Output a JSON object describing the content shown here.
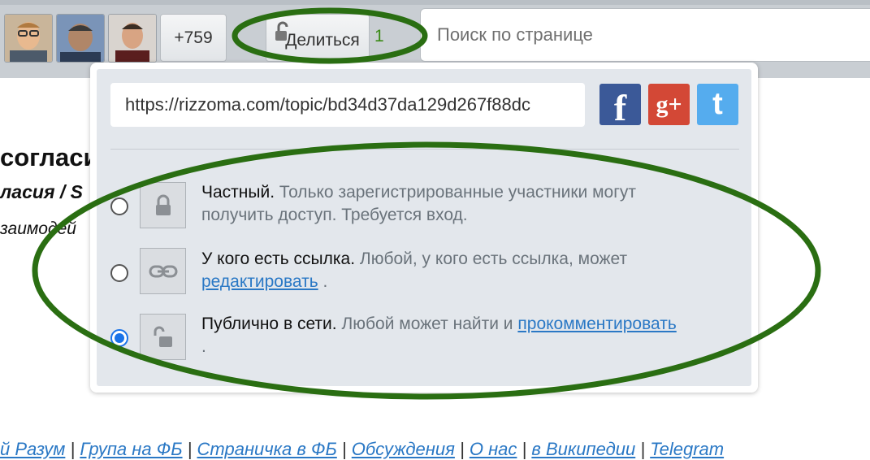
{
  "topbar": {
    "avatars": [
      "avatar-1",
      "avatar-2",
      "avatar-3"
    ],
    "more_count": "+759",
    "share_button": "Делиться",
    "share_count": "1",
    "search_placeholder": "Поиск по странице"
  },
  "background": {
    "title_fragment": "согласи",
    "subtitle_fragment": "ласия / S",
    "text_fragment": "заимодей"
  },
  "share_popup": {
    "url": "https://rizzoma.com/topic/bd34d37da129d267f88dc",
    "social": [
      {
        "name": "facebook",
        "glyph": "f",
        "color": "#3b5998"
      },
      {
        "name": "google-plus",
        "glyph": "g+",
        "color": "#d34836"
      },
      {
        "name": "twitter",
        "glyph": "t",
        "color": "#55acee"
      }
    ],
    "options": [
      {
        "title": "Частный.",
        "desc": "Только зарегистрированные участники могут получить доступ. Требуется вход.",
        "checked": false
      },
      {
        "title": "У кого есть ссылка.",
        "desc": "Любой, у кого есть ссылка, может",
        "link": "редактировать",
        "tail": ".",
        "checked": false
      },
      {
        "title": "Публично в сети.",
        "desc": "Любой может найти и",
        "link": "прокомментировать",
        "tail": ".",
        "checked": true
      }
    ]
  },
  "footer": {
    "items": [
      "й Разум",
      "Група на ФБ",
      "Страничка в ФБ",
      "Обсуждения",
      "О нас",
      "в Википедии",
      "Telegram"
    ],
    "separator": " | "
  },
  "colors": {
    "annotation": "#2a6e12",
    "link": "#2a78c5",
    "radio_checked": "#1a73e8",
    "share_count": "#3a8a16"
  }
}
